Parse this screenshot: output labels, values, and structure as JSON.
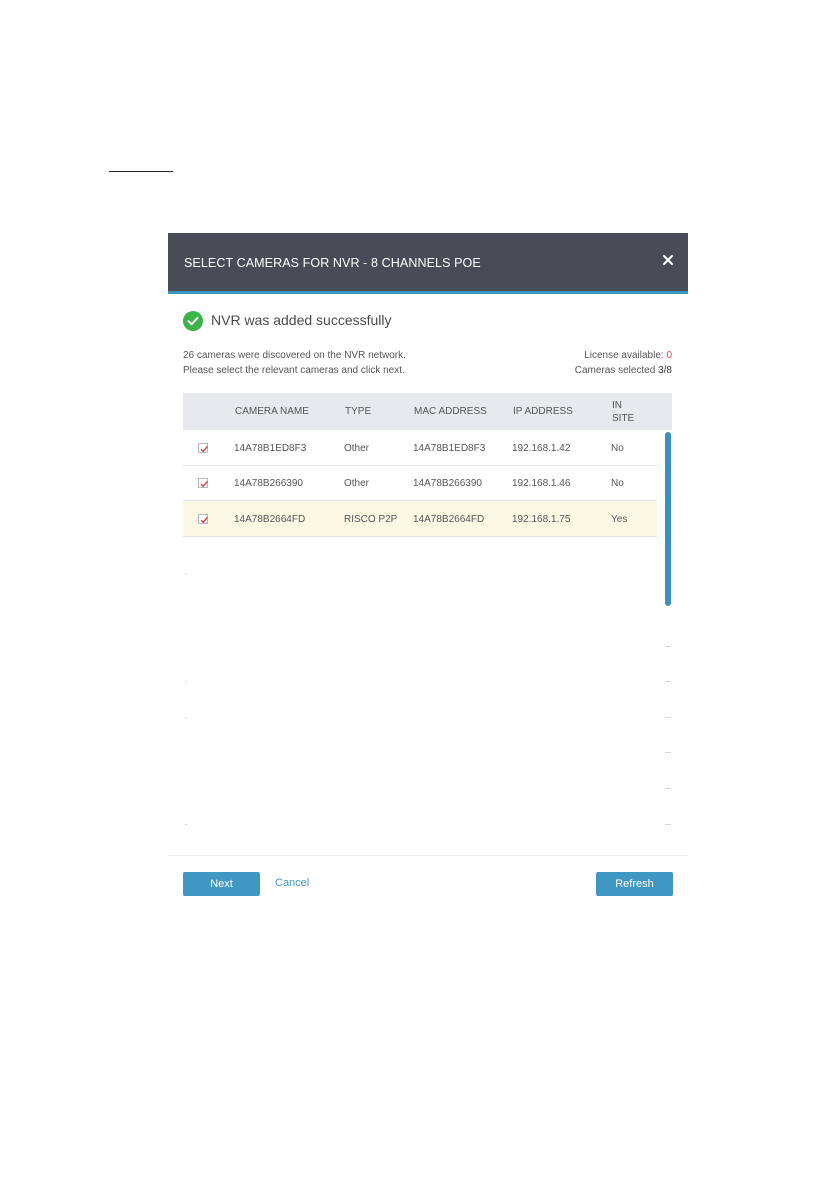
{
  "dialog": {
    "title": "SELECT CAMERAS FOR NVR - 8 CHANNELS POE",
    "close_icon": "close-icon",
    "success_message": "NVR was added successfully",
    "success_icon": "check-circle-icon",
    "info": {
      "discovered": "26 cameras were discovered on the NVR network.",
      "instruction": "Please select the relevant cameras and click next.",
      "license_label": "License available:",
      "license_value": "0",
      "selected_label": "Cameras selected",
      "selected_value": "3/8"
    },
    "table": {
      "headers": {
        "camera_name": "CAMERA NAME",
        "type": "TYPE",
        "mac": "MAC ADDRESS",
        "ip": "IP ADDRESS",
        "in_site_1": "IN",
        "in_site_2": "SITE"
      },
      "rows": [
        {
          "checked": true,
          "name": "14A78B1ED8F3",
          "type": "Other",
          "mac": "14A78B1ED8F3",
          "ip": "192.168.1.42",
          "in_site": "No"
        },
        {
          "checked": true,
          "name": "14A78B266390",
          "type": "Other",
          "mac": "14A78B266390",
          "ip": "192.168.1.46",
          "in_site": "No"
        },
        {
          "checked": true,
          "name": "14A78B2664FD",
          "type": "RISCO P2P",
          "mac": "14A78B2664FD",
          "ip": "192.168.1.75",
          "in_site": "Yes"
        }
      ]
    },
    "buttons": {
      "next": "Next",
      "cancel": "Cancel",
      "refresh": "Refresh"
    }
  },
  "colors": {
    "header_bg": "#474c56",
    "accent": "#3f97c3",
    "success": "#3bb54a",
    "highlight_row": "#fbf8e3",
    "license_zero": "#e04b4b",
    "checkbox_mark": "#d23c3c"
  }
}
